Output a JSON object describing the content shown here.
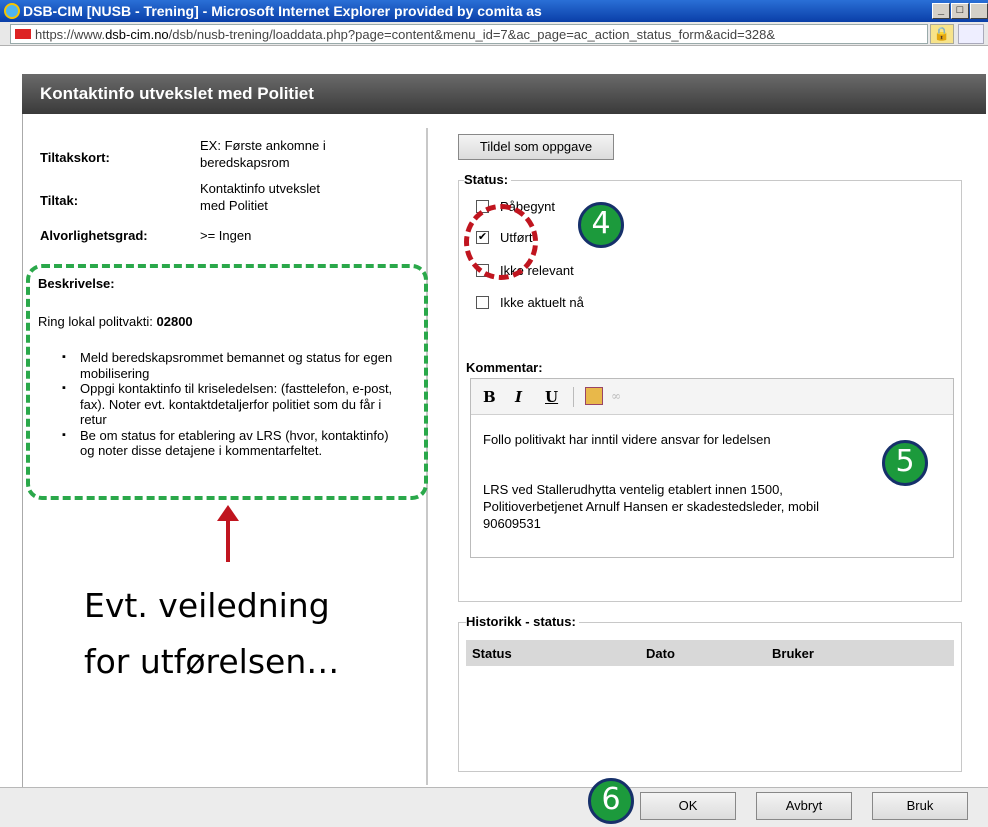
{
  "window": {
    "title": "DSB-CIM [NUSB - Trening] - Microsoft Internet Explorer provided by comita as",
    "minimize": "_",
    "maximize": "□"
  },
  "address": {
    "prefix": "https://www.",
    "domain": "dsb-cim.no",
    "path": "/dsb/nusb-trening/loaddata.php?page=content&menu_id=7&ac_page=ac_action_status_form&acid=328&"
  },
  "dialog": {
    "title": "Kontaktinfo utvekslet med Politiet"
  },
  "details": {
    "tiltakskort_label": "Tiltakskort:",
    "tiltakskort_value_1": "EX: Første ankomne i",
    "tiltakskort_value_2": "beredskapsrom",
    "tiltak_label": "Tiltak:",
    "tiltak_value_1": "Kontaktinfo utvekslet",
    "tiltak_value_2": "med Politiet",
    "alvorlighet_label": "Alvorlighetsgrad:",
    "alvorlighet_value": ">= Ingen"
  },
  "description": {
    "label": "Beskrivelse:",
    "intro": "Ring lokal politvakti: ",
    "intro_number": "02800",
    "bullets": [
      "Meld beredskapsrommet bemannet og status for egen mobilisering",
      "Oppgi kontaktinfo til kriseledelsen: (fasttelefon, e-post, fax). Noter evt. kontaktdetaljerfor politiet som du får i retur",
      "Be om status for etablering av LRS (hvor, kontaktinfo) og noter disse detajene i kommentarfeltet."
    ]
  },
  "annotation": {
    "line1": "Evt. veiledning",
    "line2": "for utførelsen…"
  },
  "assign_button": "Tildel som oppgave",
  "status": {
    "legend": "Status:",
    "options": [
      {
        "label": "Påbegynt",
        "checked": false
      },
      {
        "label": "Utført",
        "checked": true
      },
      {
        "label": "Ikke relevant",
        "checked": false
      },
      {
        "label": "Ikke aktuelt nå",
        "checked": false
      }
    ]
  },
  "comment": {
    "legend": "Kommentar:",
    "toolbar": {
      "bold": "B",
      "italic": "I",
      "underline": "U"
    },
    "line1": "Follo politivakt har inntil videre ansvar for ledelsen",
    "line2": "LRS ved Stallerudhytta ventelig etablert innen 1500,",
    "line3": "Politioverbetjenet Arnulf Hansen er skadestedsleder, mobil",
    "line4": "90609531"
  },
  "history": {
    "legend": "Historikk - status:",
    "columns": [
      "Status",
      "Dato",
      "Bruker"
    ]
  },
  "footer": {
    "ok": "OK",
    "cancel": "Avbryt",
    "apply": "Bruk"
  },
  "markers": {
    "step4": "4",
    "step5": "5",
    "step6": "6"
  },
  "colors": {
    "marker_green": "#1c9a3c",
    "annotation_red": "#c0151f",
    "dashed_green": "#2aa84a",
    "header_dark": "#4a4a4a"
  }
}
